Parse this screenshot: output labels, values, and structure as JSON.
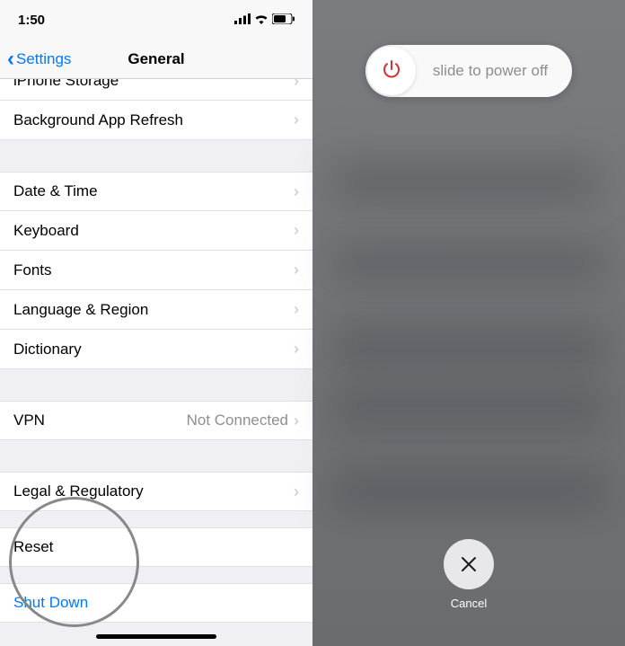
{
  "status": {
    "time": "1:50"
  },
  "nav": {
    "back_label": "Settings",
    "title": "General"
  },
  "rows": {
    "iphone_storage": "iPhone Storage",
    "background_refresh": "Background App Refresh",
    "date_time": "Date & Time",
    "keyboard": "Keyboard",
    "fonts": "Fonts",
    "language_region": "Language & Region",
    "dictionary": "Dictionary",
    "vpn_label": "VPN",
    "vpn_value": "Not Connected",
    "legal": "Legal & Regulatory",
    "reset": "Reset",
    "shut_down": "Shut Down"
  },
  "power_off": {
    "slider_text": "slide to power off",
    "cancel": "Cancel"
  }
}
